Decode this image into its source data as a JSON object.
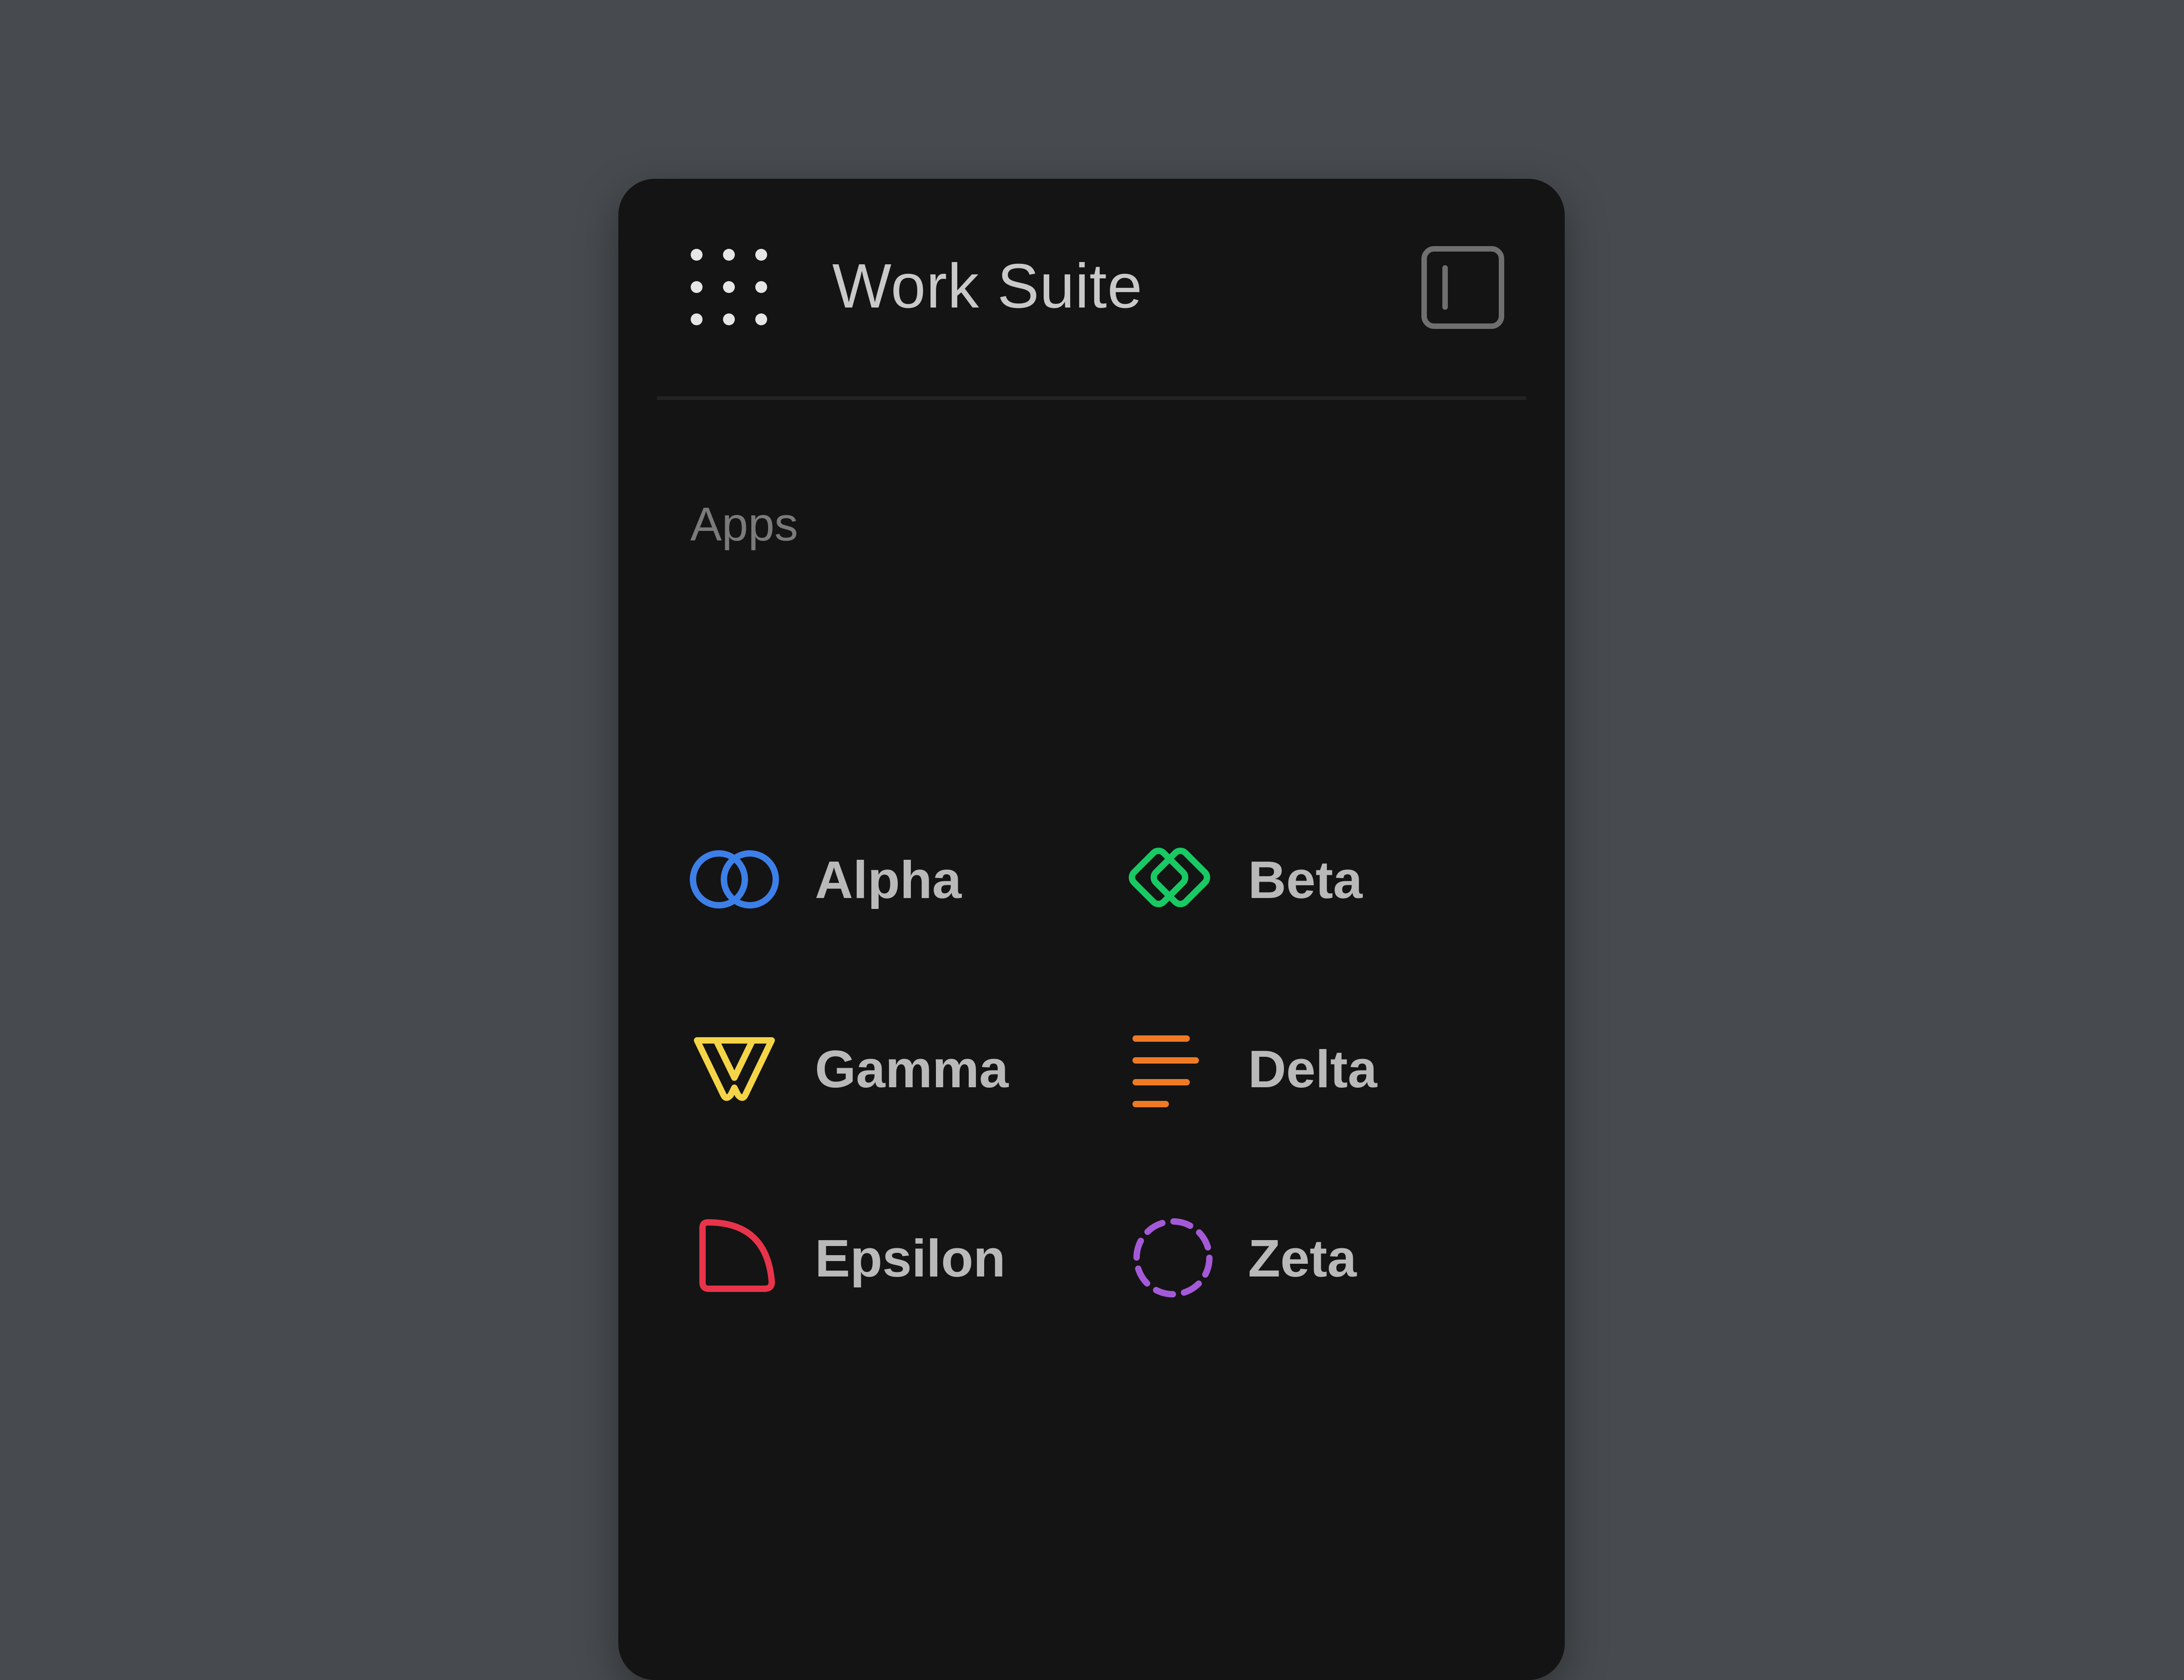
{
  "header": {
    "title": "Work Suite",
    "menu_icon": "app-grid-icon",
    "toggle_icon": "sidebar-toggle-icon"
  },
  "apps_section": {
    "label": "Apps",
    "items": [
      {
        "label": "Alpha",
        "icon": "overlapping-circles-icon",
        "color": "#3d7fe8"
      },
      {
        "label": "Beta",
        "icon": "linked-diamonds-icon",
        "color": "#18c964"
      },
      {
        "label": "Gamma",
        "icon": "w-shape-icon",
        "color": "#f5d547"
      },
      {
        "label": "Delta",
        "icon": "stacked-lines-icon",
        "color": "#f07a24"
      },
      {
        "label": "Epsilon",
        "icon": "quarter-circle-icon",
        "color": "#e8344a"
      },
      {
        "label": "Zeta",
        "icon": "dashed-circle-icon",
        "color": "#a45ad8"
      }
    ]
  },
  "colors": {
    "page_background": "#474b4f",
    "panel_background": "#141414",
    "title_text": "#c9c9c9",
    "section_label_text": "#7a7a7a",
    "app_label_text": "#b9b9b9"
  }
}
